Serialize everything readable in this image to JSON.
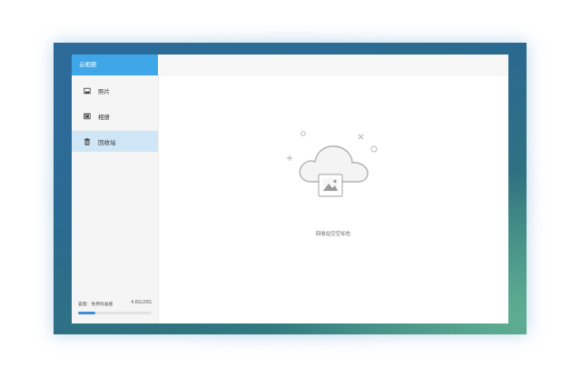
{
  "app": {
    "title": "云相册"
  },
  "sidebar": {
    "items": [
      {
        "label": "照片",
        "icon": "photo-icon",
        "active": false
      },
      {
        "label": "相册",
        "icon": "album-icon",
        "active": false
      },
      {
        "label": "回收站",
        "icon": "trash-icon",
        "active": true
      }
    ],
    "storage": {
      "label": "容量：免费标准版",
      "usage": "4.6G/20G",
      "fraction": 0.23
    }
  },
  "main": {
    "empty_message": "回收站空空如也",
    "empty_icon": "cloud-image-icon"
  },
  "colors": {
    "accent": "#3fa7e8",
    "active_item": "#cfe6f6",
    "progress": "#3b8ed6"
  }
}
